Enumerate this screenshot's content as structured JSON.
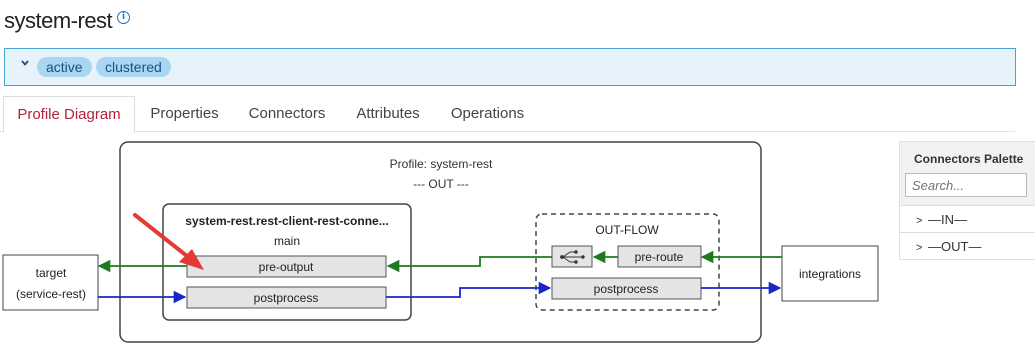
{
  "page": {
    "title": "system-rest",
    "info_icon": "info-icon"
  },
  "status": {
    "badges": [
      "active",
      "clustered"
    ],
    "toggle_icon": "chevron-down-icon"
  },
  "tabs": [
    {
      "label": "Profile Diagram",
      "active": true
    },
    {
      "label": "Properties"
    },
    {
      "label": "Connectors"
    },
    {
      "label": "Attributes"
    },
    {
      "label": "Operations"
    }
  ],
  "diagram": {
    "profile_title": "Profile: system-rest",
    "profile_subtitle": "--- OUT ---",
    "connector_title": "system-rest.rest-client-rest-conne...",
    "connector_subtitle": "main",
    "pre_output": "pre-output",
    "postprocess": "postprocess",
    "outflow_title": "OUT-FLOW",
    "pre_route": "pre-route",
    "outflow_postprocess": "postprocess",
    "target_line1": "target",
    "target_line2": "(service-rest)",
    "integrations": "integrations",
    "colors": {
      "in_flow": "#1f7a1f",
      "out_flow": "#1a24c8",
      "annotation_arrow": "#e53935"
    }
  },
  "palette": {
    "title": "Connectors Palette",
    "search_placeholder": "Search...",
    "items": [
      "—IN—",
      "—OUT—"
    ]
  }
}
